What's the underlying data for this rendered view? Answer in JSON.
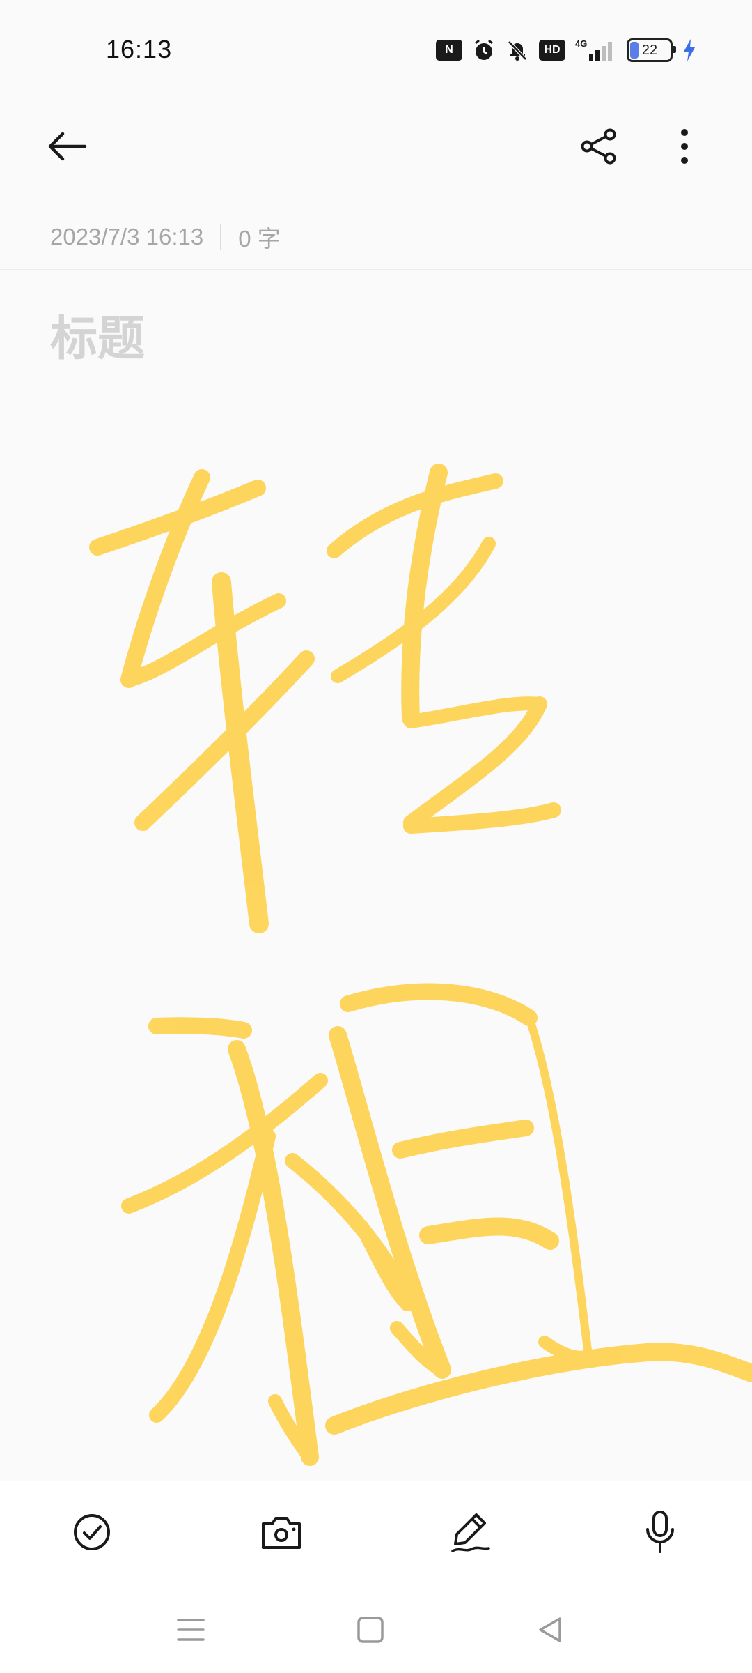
{
  "status_bar": {
    "time": "16:13",
    "icons": [
      "nfc-icon",
      "alarm-icon",
      "mute-icon",
      "hd-icon",
      "signal-4g-icon",
      "battery-icon",
      "charging-icon"
    ],
    "hd_label": "HD",
    "network_label": "4G",
    "battery_level": "22",
    "battery_fraction": 0.22
  },
  "toolbar": {
    "icons": [
      "back-arrow-icon",
      "share-icon",
      "more-vertical-icon"
    ]
  },
  "note": {
    "timestamp": "2023/7/3 16:13",
    "char_count": "0 字",
    "title_placeholder": "标题",
    "ink_color": "#ffc51a"
  },
  "bottom_toolbar": {
    "icons": [
      "checklist-icon",
      "camera-icon",
      "pen-icon",
      "microphone-icon"
    ]
  },
  "nav_bar": {
    "icons": [
      "menu-icon",
      "home-icon",
      "back-triangle-icon"
    ]
  }
}
